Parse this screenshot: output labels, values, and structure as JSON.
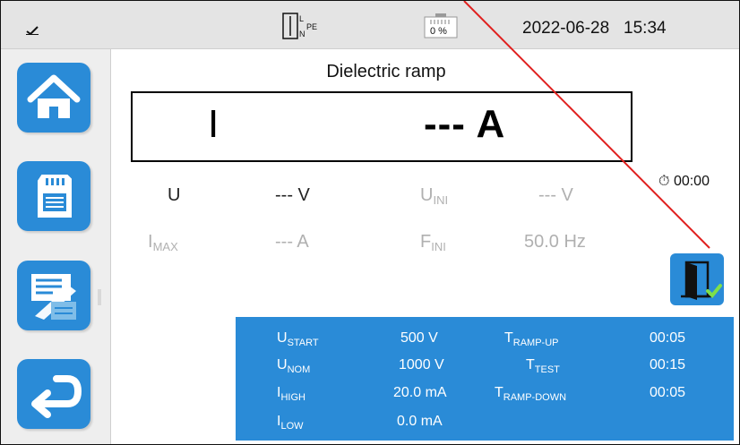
{
  "status": {
    "battery_percent": "0 %",
    "date": "2022-06-28",
    "time": "15:34"
  },
  "sidebar": {
    "items": [
      {
        "name": "home",
        "icon": "home-icon"
      },
      {
        "name": "memory",
        "icon": "sd-card-icon"
      },
      {
        "name": "records",
        "icon": "records-icon"
      },
      {
        "name": "back",
        "icon": "return-arrow-icon"
      }
    ]
  },
  "main": {
    "title": "Dielectric ramp",
    "measure": {
      "label": "I",
      "value": "--- A"
    },
    "u_label": "U",
    "u_value": "--- V",
    "uini_label": "U",
    "uini_sub": "INI",
    "uini_value": "--- V",
    "imax_label": "I",
    "imax_sub": "MAX",
    "imax_value": "--- A",
    "fini_label": "F",
    "fini_sub": "INI",
    "fini_value": "50.0 Hz",
    "timer": "00:00"
  },
  "params": {
    "ustart": {
      "label": "U",
      "sub": "START",
      "value": "500 V"
    },
    "unom": {
      "label": "U",
      "sub": "NOM",
      "value": "1000 V"
    },
    "ihigh": {
      "label": "I",
      "sub": "HIGH",
      "value": "20.0 mA"
    },
    "ilow": {
      "label": "I",
      "sub": "LOW",
      "value": "0.0 mA"
    },
    "trampup": {
      "label": "T",
      "sub": "RAMP-UP",
      "value": "00:05"
    },
    "ttest": {
      "label": "T",
      "sub": "TEST",
      "value": "00:15"
    },
    "trampdown": {
      "label": "T",
      "sub": "RAMP-DOWN",
      "value": "00:05"
    }
  },
  "colors": {
    "accent": "#2a8bd7",
    "annotation_line": "#e0201f"
  }
}
